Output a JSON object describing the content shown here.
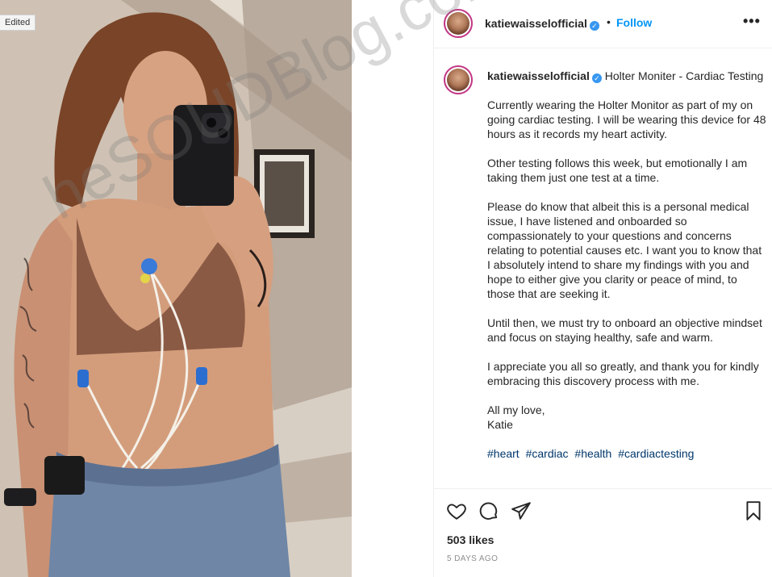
{
  "photo": {
    "edited_label": "Edited"
  },
  "header": {
    "username": "katiewaisselofficial",
    "separator": "•",
    "follow_label": "Follow",
    "more_label": "•••"
  },
  "caption": {
    "username": "katiewaisselofficial",
    "title": "Holter Moniter - Cardiac Testing",
    "paragraphs": [
      "Currently wearing the Holter Monitor as part of my on going cardiac testing. I will be wearing this device for 48 hours as it records my heart activity.",
      "Other testing follows this week, but emotionally I am taking them just one test at a time.",
      "Please do know that albeit this is a personal medical issue, I have listened and onboarded so compassionately to your questions and concerns relating to potential causes etc. I want you to know that I absolutely intend to share my findings with you and hope to either give you clarity or peace of mind, to those that are seeking it.",
      "Until then, we must try to onboard an objective mindset and focus on staying healthy, safe and warm.",
      "I appreciate you all so greatly, and thank you for kindly embracing this discovery process with me."
    ],
    "signoff_1": "All my love,",
    "signoff_2": "Katie",
    "hashtags": [
      "#heart",
      "#cardiac",
      "#health",
      "#cardiactesting"
    ]
  },
  "watermark": "heSOUDBlog.com",
  "actions": {
    "icons": [
      "heart-icon",
      "comment-icon",
      "share-icon",
      "bookmark-icon"
    ],
    "likes": "503 likes",
    "time": "5 DAYS AGO"
  },
  "colors": {
    "link": "#0095f6",
    "hashtag": "#00376b",
    "verified": "#3897f0",
    "avatar_ring": "#c13584"
  }
}
